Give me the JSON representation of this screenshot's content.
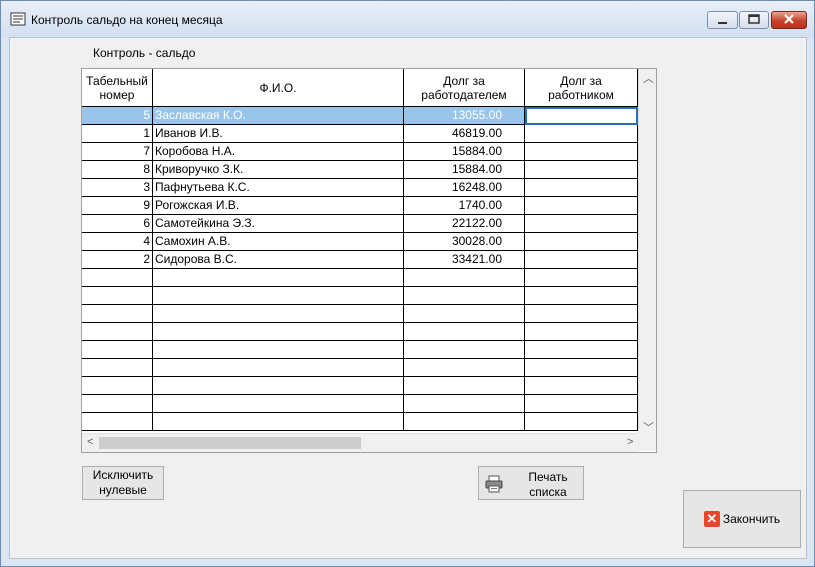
{
  "window": {
    "title": "Контроль сальдо на конец месяца",
    "icons": {
      "app": "ledger-icon",
      "minimize": "minimize-icon",
      "maximize": "maximize-icon",
      "close": "close-icon"
    }
  },
  "caption": "Контроль - сальдо",
  "table": {
    "headers": {
      "tab_no": [
        "Табельный",
        "номер"
      ],
      "name": "Ф.И.О.",
      "employer_debt": [
        "Долг за",
        "работодателем"
      ],
      "employee_debt": [
        "Долг за",
        "работником"
      ]
    },
    "rows": [
      {
        "tab_no": "5",
        "name": "Заславская К.О.",
        "employer_debt": "13055.00",
        "employee_debt": "",
        "selected": true
      },
      {
        "tab_no": "1",
        "name": "Иванов И.В.",
        "employer_debt": "46819.00",
        "employee_debt": ""
      },
      {
        "tab_no": "7",
        "name": "Коробова Н.А.",
        "employer_debt": "15884.00",
        "employee_debt": ""
      },
      {
        "tab_no": "8",
        "name": "Криворучко З.К.",
        "employer_debt": "15884.00",
        "employee_debt": ""
      },
      {
        "tab_no": "3",
        "name": "Пафнутьева К.С.",
        "employer_debt": "16248.00",
        "employee_debt": ""
      },
      {
        "tab_no": "9",
        "name": "Рогожская И.В.",
        "employer_debt": "1740.00",
        "employee_debt": ""
      },
      {
        "tab_no": "6",
        "name": "Самотейкина Э.З.",
        "employer_debt": "22122.00",
        "employee_debt": ""
      },
      {
        "tab_no": "4",
        "name": "Самохин А.В.",
        "employer_debt": "30028.00",
        "employee_debt": ""
      },
      {
        "tab_no": "2",
        "name": "Сидорова В.С.",
        "employer_debt": "33421.00",
        "employee_debt": ""
      }
    ],
    "empty_rows": 9
  },
  "buttons": {
    "exclude_zero": [
      "Исключить",
      "нулевые"
    ],
    "print_list": [
      "Печать",
      "списка"
    ],
    "finish": "Закончить"
  },
  "colors": {
    "selected_row": "#99c5ea",
    "close_button": "#c4432b",
    "finish_icon": "#e8452b"
  }
}
